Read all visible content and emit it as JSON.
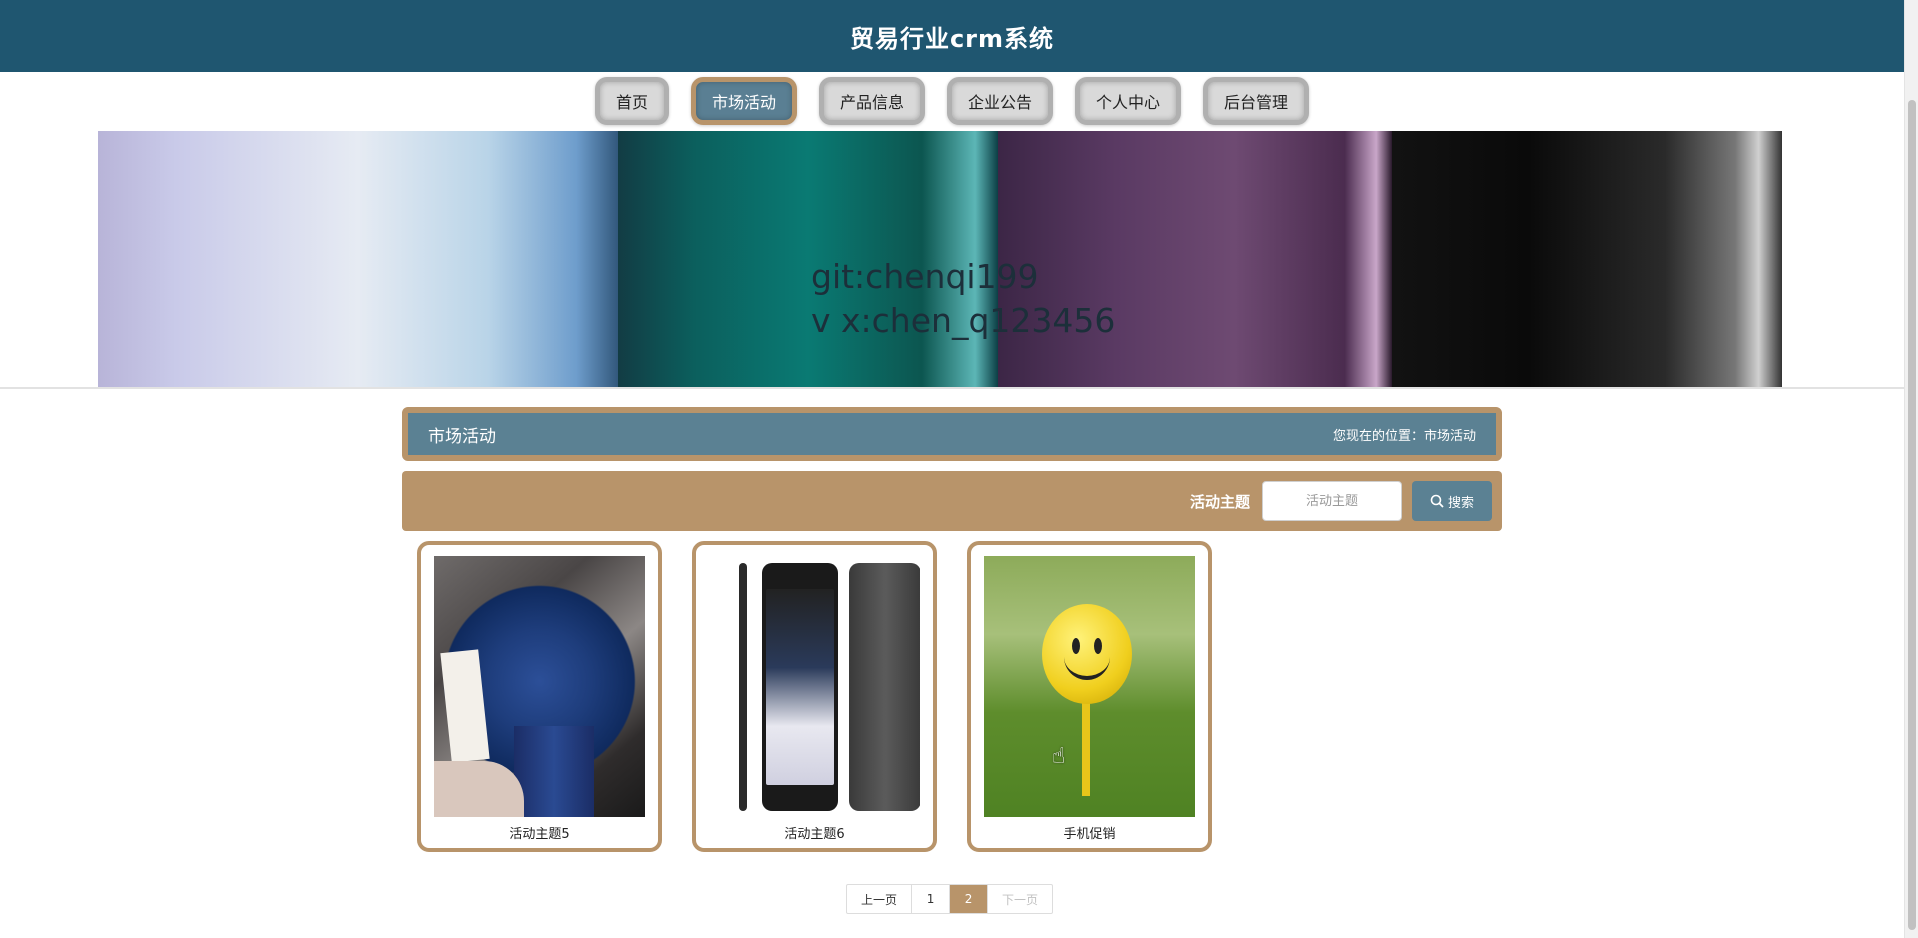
{
  "header": {
    "title": "贸易行业crm系统"
  },
  "nav": {
    "items": [
      {
        "label": "首页",
        "active": false
      },
      {
        "label": "市场活动",
        "active": true
      },
      {
        "label": "产品信息",
        "active": false
      },
      {
        "label": "企业公告",
        "active": false
      },
      {
        "label": "个人中心",
        "active": false
      },
      {
        "label": "后台管理",
        "active": false
      }
    ]
  },
  "banner": {
    "line1": "git:chenqi199",
    "line2": "v x:chen_q123456"
  },
  "breadcrumb": {
    "section_title": "市场活动",
    "location_label": "您现在的位置：市场活动"
  },
  "search": {
    "label": "活动主题",
    "placeholder": "活动主题",
    "value": "",
    "button_label": "搜索"
  },
  "cards": [
    {
      "caption": "活动主题5",
      "image": "wristwatch-photo"
    },
    {
      "caption": "活动主题6",
      "image": "smartphone-photo"
    },
    {
      "caption": "手机促销",
      "image": "smiley-golf-ball-photo"
    }
  ],
  "pagination": {
    "prev": "上一页",
    "pages": [
      "1",
      "2"
    ],
    "current": "2",
    "next": "下一页"
  },
  "colors": {
    "header_bg": "#1f5670",
    "accent_tan": "#b8946a",
    "accent_blue": "#5b8193"
  }
}
